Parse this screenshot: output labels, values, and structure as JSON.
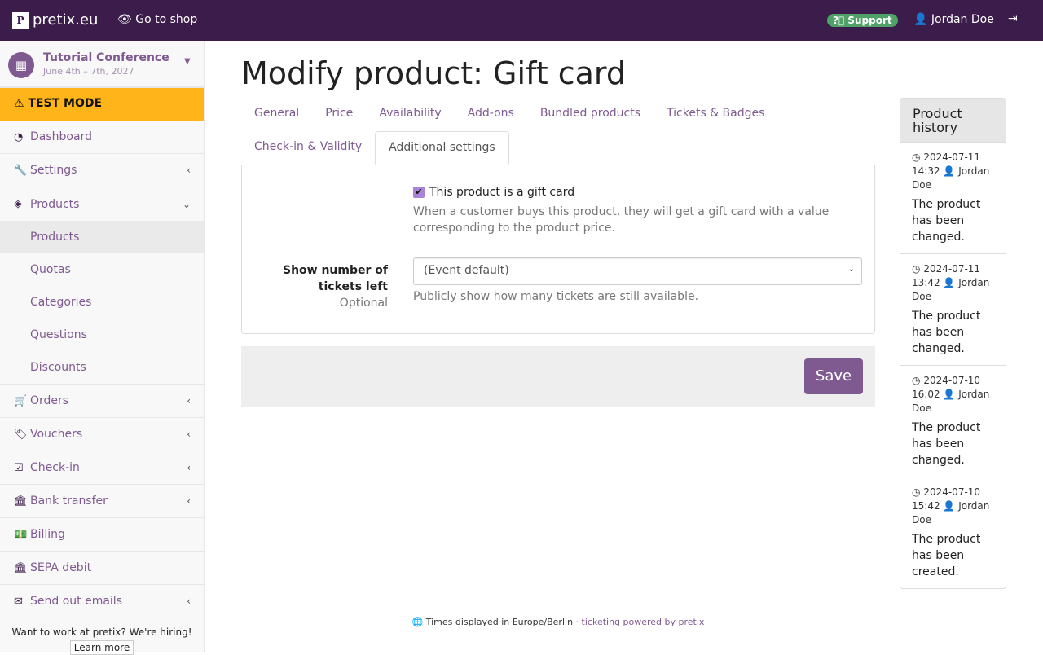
{
  "topbar": {
    "brand": "pretix.eu",
    "go_to_shop": "Go to shop",
    "support": "Support",
    "user": "Jordan Doe"
  },
  "event": {
    "name": "Tutorial Conference",
    "dates": "June 4th – 7th, 2027"
  },
  "test_mode": "TEST MODE",
  "nav": {
    "dashboard": "Dashboard",
    "settings": "Settings",
    "products": "Products",
    "sub": [
      "Products",
      "Quotas",
      "Categories",
      "Questions",
      "Discounts"
    ],
    "orders": "Orders",
    "vouchers": "Vouchers",
    "checkin": "Check-in",
    "bank": "Bank transfer",
    "billing": "Billing",
    "sepa": "SEPA debit",
    "emails": "Send out emails"
  },
  "hiring": {
    "text": "Want to work at pretix? We're hiring!",
    "button": "Learn more"
  },
  "page_title": "Modify product: Gift card",
  "tabs": [
    "General",
    "Price",
    "Availability",
    "Add-ons",
    "Bundled products",
    "Tickets & Badges",
    "Check-in & Validity",
    "Additional settings"
  ],
  "form": {
    "gift_card_label": "This product is a gift card",
    "gift_card_checked": true,
    "gift_card_help": "When a customer buys this product, they will get a gift card with a value corresponding to the product price.",
    "tickets_left_label": "Show number of tickets left",
    "optional": "Optional",
    "tickets_left_value": "(Event default)",
    "tickets_left_help": "Publicly show how many tickets are still available.",
    "save": "Save"
  },
  "history": {
    "title": "Product history",
    "entries": [
      {
        "date": "2024-07-11",
        "time": "14:32",
        "user": "Jordan Doe",
        "text": "The product has been changed."
      },
      {
        "date": "2024-07-11",
        "time": "13:42",
        "user": "Jordan Doe",
        "text": "The product has been changed."
      },
      {
        "date": "2024-07-10",
        "time": "16:02",
        "user": "Jordan Doe",
        "text": "The product has been changed."
      },
      {
        "date": "2024-07-10",
        "time": "15:42",
        "user": "Jordan Doe",
        "text": "The product has been created."
      }
    ]
  },
  "footer": {
    "tz": "Times displayed in Europe/Berlin",
    "sep": " · ",
    "powered": "ticketing powered by pretix"
  },
  "colors": {
    "topbar": "#3b1c4a",
    "accent": "#7f5a91",
    "test_mode": "#ffb419",
    "support": "#50a167"
  }
}
